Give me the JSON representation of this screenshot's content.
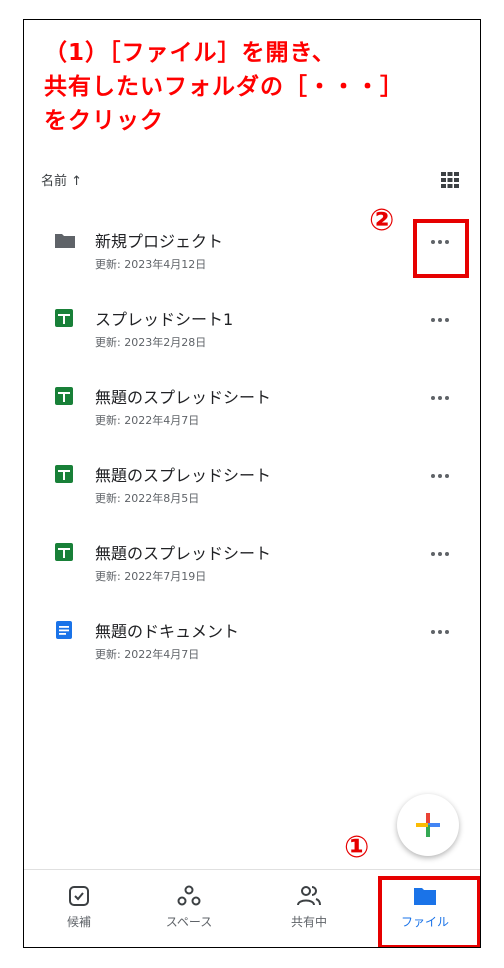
{
  "instruction": {
    "line1": "（1）［ファイル］を開き、",
    "line2": "共有したいフォルダの［・・・］",
    "line3": "をクリック"
  },
  "sort": {
    "label": "名前 ↑",
    "view_icon": "grid-view-icon"
  },
  "files": [
    {
      "name": "新規プロジェクト",
      "meta": "更新: 2023年4月12日",
      "icon": "folder-icon",
      "more": "•••"
    },
    {
      "name": "スプレッドシート1",
      "meta": "更新: 2023年2月28日",
      "icon": "spreadsheet-icon",
      "more": "•••"
    },
    {
      "name": "無題のスプレッドシート",
      "meta": "更新: 2022年4月7日",
      "icon": "spreadsheet-icon",
      "more": "•••"
    },
    {
      "name": "無題のスプレッドシート",
      "meta": "更新: 2022年8月5日",
      "icon": "spreadsheet-icon",
      "more": "•••"
    },
    {
      "name": "無題のスプレッドシート",
      "meta": "更新: 2022年7月19日",
      "icon": "spreadsheet-icon",
      "more": "•••"
    },
    {
      "name": "無題のドキュメント",
      "meta": "更新: 2022年4月7日",
      "icon": "document-icon",
      "more": "•••"
    }
  ],
  "annotations": {
    "step1": "①",
    "step2": "②"
  },
  "fab": {
    "icon": "plus-icon"
  },
  "nav": [
    {
      "label": "候補",
      "icon": "suggested-icon",
      "active": false
    },
    {
      "label": "スペース",
      "icon": "spaces-icon",
      "active": false
    },
    {
      "label": "共有中",
      "icon": "shared-icon",
      "active": false
    },
    {
      "label": "ファイル",
      "icon": "files-icon",
      "active": true
    }
  ],
  "colors": {
    "annotation_red": "#e60000",
    "folder_gray": "#5f6368",
    "sheets_green": "#188038",
    "docs_blue": "#1a73e8",
    "active_blue": "#1a73e8"
  }
}
